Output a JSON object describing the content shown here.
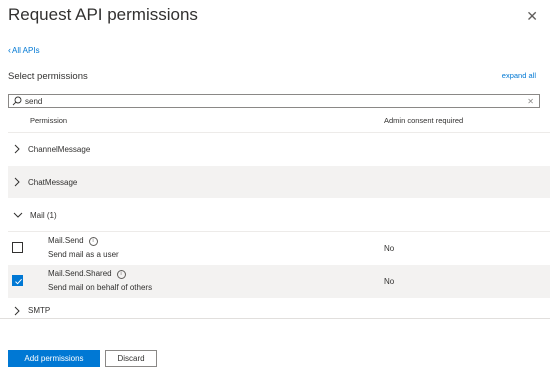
{
  "panel": {
    "title": "Request API permissions",
    "back_link": "All APIs",
    "select_label": "Select permissions",
    "expand_all": "expand all"
  },
  "search": {
    "value": "send",
    "placeholder": ""
  },
  "table": {
    "col_permission": "Permission",
    "col_admin": "Admin consent required"
  },
  "groups": [
    {
      "label": "ChannelMessage",
      "expanded": false
    },
    {
      "label": "ChatMessage",
      "expanded": false
    },
    {
      "label": "Mail (1)",
      "expanded": true
    },
    {
      "label": "SMTP",
      "expanded": false
    }
  ],
  "permissions": [
    {
      "name": "Mail.Send",
      "description": "Send mail as a user",
      "admin": "No",
      "checked": false
    },
    {
      "name": "Mail.Send.Shared",
      "description": "Send mail on behalf of others",
      "admin": "No",
      "checked": true
    }
  ],
  "footer": {
    "add_label": "Add permissions",
    "discard_label": "Discard"
  },
  "colors": {
    "accent": "#0078d4",
    "shaded_row": "#f3f2f1"
  }
}
